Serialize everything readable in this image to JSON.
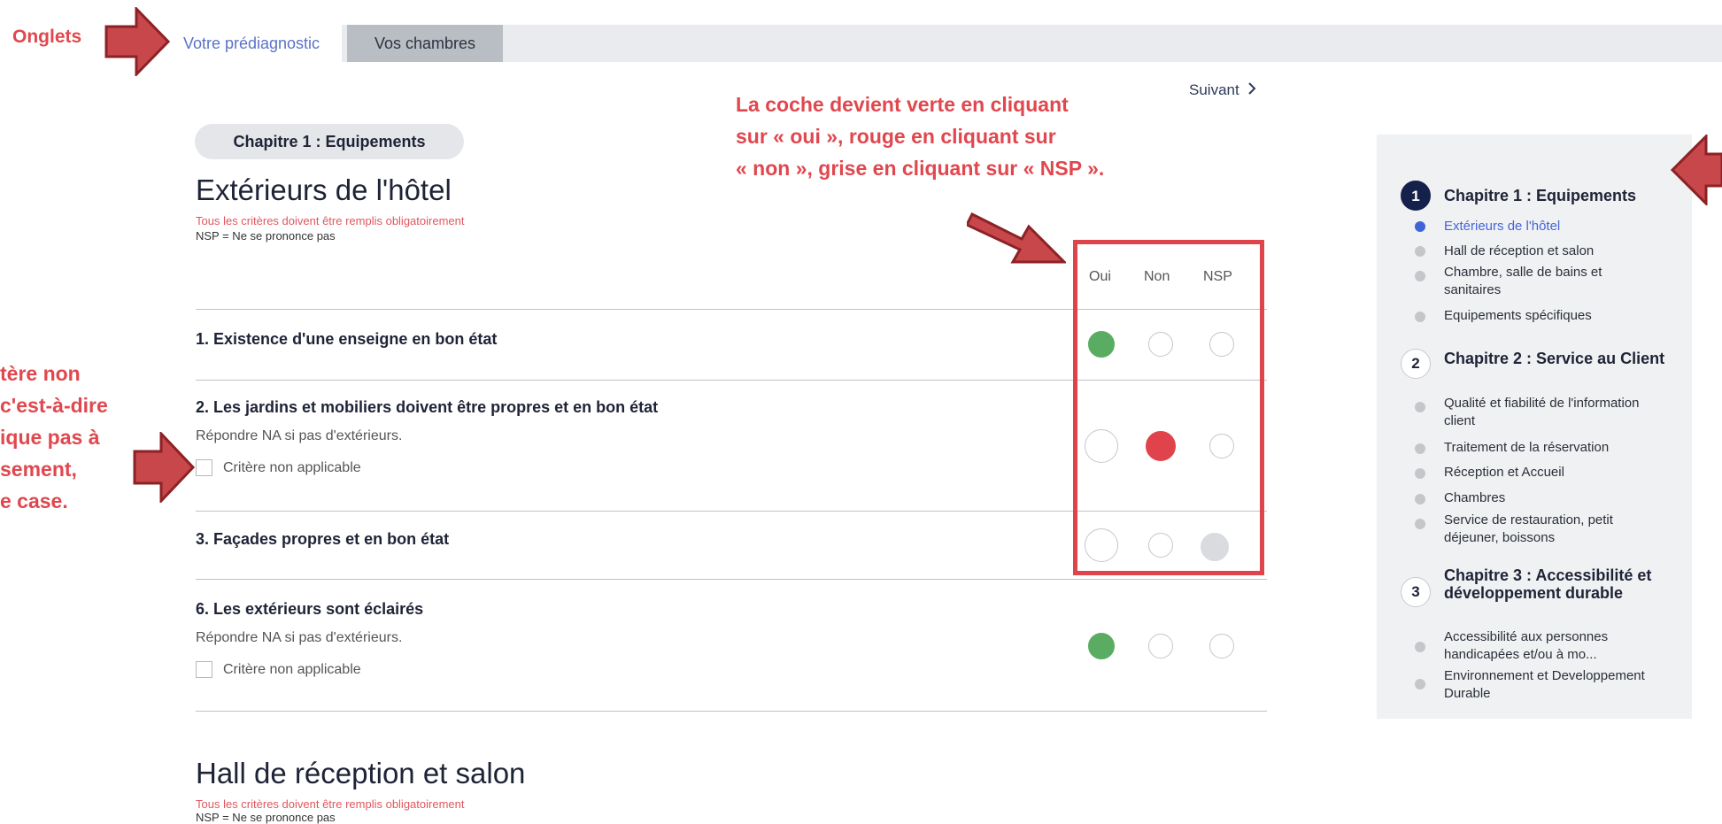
{
  "tabs": [
    {
      "label": "Votre prédiagnostic",
      "active": true
    },
    {
      "label": "Vos chambres",
      "active": false
    }
  ],
  "next_label": "Suivant",
  "chapter_pill": "Chapitre 1 : Equipements",
  "section1": {
    "title": "Extérieurs de l'hôtel",
    "required_note": "Tous les critères doivent être remplis obligatoirement",
    "nsp_note": "NSP = Ne se prononce pas"
  },
  "columns": [
    "Oui",
    "Non",
    "NSP"
  ],
  "questions": [
    {
      "title": "1. Existence d'une enseigne en bon état",
      "hint": "",
      "na_label": "",
      "answer": "Oui"
    },
    {
      "title": "2. Les jardins et mobiliers doivent être propres et en bon état",
      "hint": "Répondre NA si pas d'extérieurs.",
      "na_label": "Critère non applicable",
      "answer": "Non"
    },
    {
      "title": "3. Façades propres et en bon état",
      "hint": "",
      "na_label": "",
      "answer": "NSP"
    },
    {
      "title": "6. Les extérieurs sont éclairés",
      "hint": "Répondre NA si pas d'extérieurs.",
      "na_label": "Critère non applicable",
      "answer": "Oui"
    }
  ],
  "section2": {
    "title": "Hall de réception et salon",
    "required_note": "Tous les critères doivent être remplis obligatoirement",
    "nsp_note": "NSP = Ne se prononce pas"
  },
  "annotations": {
    "tabs_label": "Onglets",
    "check_color_lines": [
      "La coche devient verte en cliquant",
      "sur « oui », rouge en cliquant sur",
      "« non », grise en cliquant sur « NSP »."
    ],
    "na_lines": [
      "tère non",
      "c'est-à-dire",
      "ique pas à",
      "sement,",
      "e case."
    ]
  },
  "sidebar": {
    "chapters": [
      {
        "num": "1",
        "title": "Chapitre 1 : Equipements",
        "active": true,
        "items": [
          "Extérieurs de l'hôtel",
          "Hall de réception et salon",
          "Chambre, salle de bains et sanitaires",
          "Equipements spécifiques"
        ]
      },
      {
        "num": "2",
        "title": "Chapitre 2 : Service au Client",
        "active": false,
        "items": [
          "Qualité et fiabilité de l'information client",
          "Traitement de la réservation",
          "Réception et Accueil",
          "Chambres",
          "Service de restauration, petit déjeuner, boissons"
        ]
      },
      {
        "num": "3",
        "title": "Chapitre 3 : Accessibilité et développement durable",
        "active": false,
        "items": [
          "Accessibilité aux personnes handicapées et/ou à mo...",
          "Environnement et Developpement Durable"
        ]
      }
    ]
  },
  "colors": {
    "oui": "#5aac63",
    "non": "#e0434b",
    "nsp": "#d9dbdf",
    "annotation": "#e0474e",
    "arrow_fill": "#c7474b",
    "arrow_stroke": "#8c2226"
  }
}
